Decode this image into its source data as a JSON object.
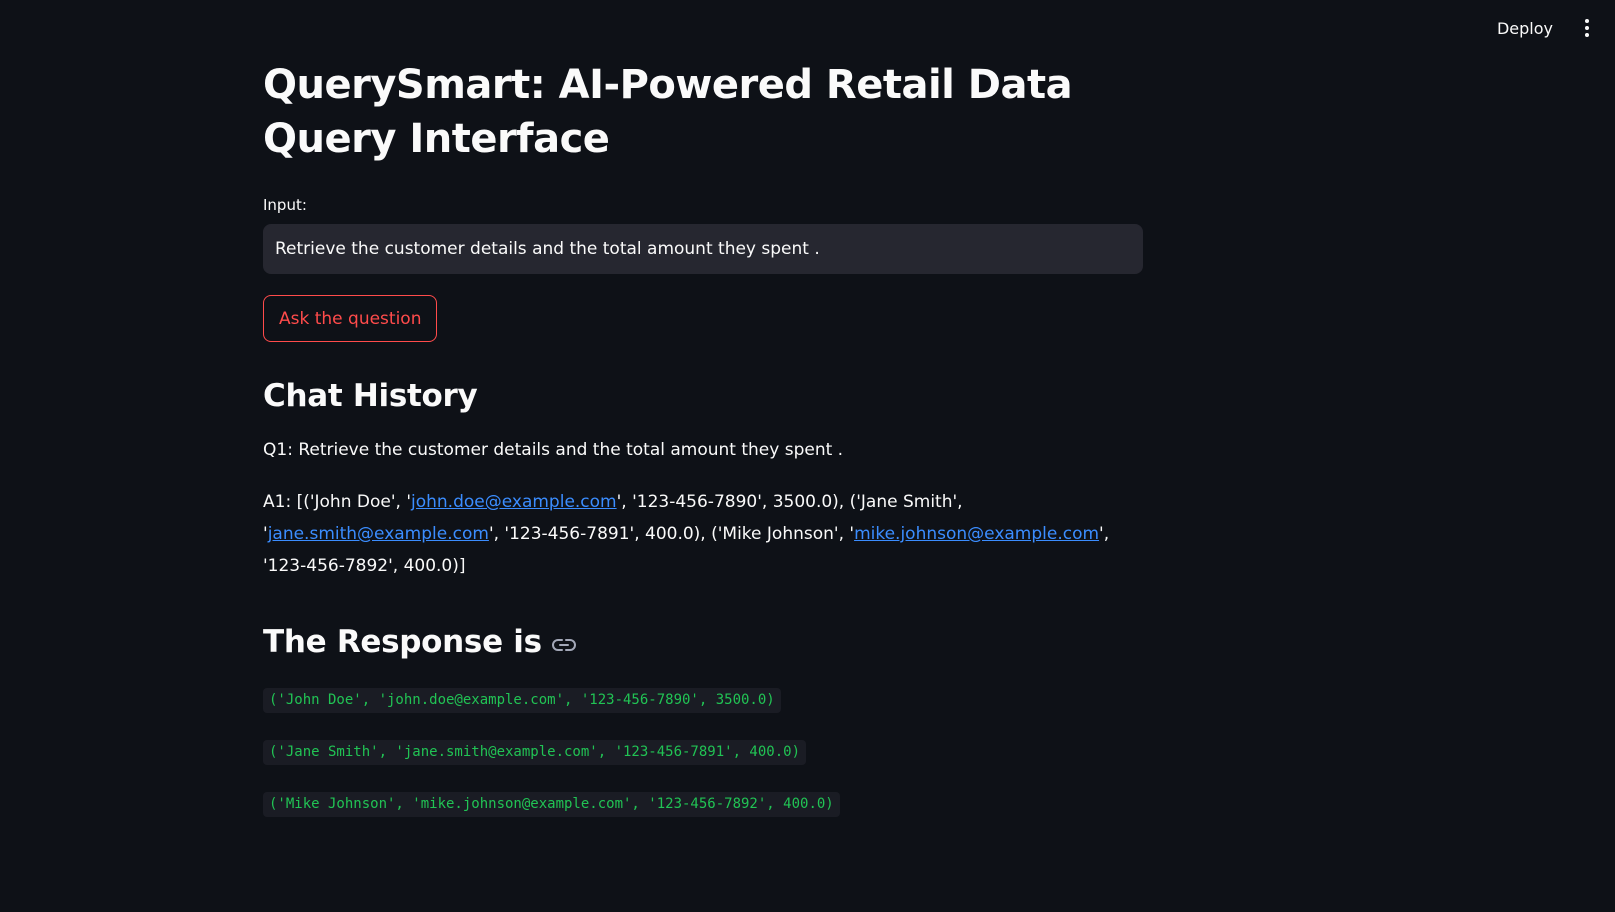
{
  "header": {
    "deploy_label": "Deploy",
    "menu_icon": "kebab-menu-icon"
  },
  "main": {
    "title": "QuerySmart: AI-Powered Retail Data Query Interface",
    "input_label": "Input:",
    "input_value": "Retrieve the customer details and the total amount they spent .",
    "ask_button_label": "Ask the question"
  },
  "chat": {
    "heading": "Chat History",
    "question": "Q1: Retrieve the customer details and the total amount they spent .",
    "answer_parts": {
      "p1": "A1: [('John Doe', '",
      "link1": "john.doe@example.com",
      "p2": "', '123-456-7890', 3500.0), ('Jane Smith', '",
      "link2": "jane.smith@example.com",
      "p3": "', '123-456-7891', 400.0), ('Mike Johnson', '",
      "link3": "mike.johnson@example.com",
      "p4": "', '123-456-7892', 400.0)]"
    }
  },
  "response": {
    "heading": "The Response is",
    "anchor_icon": "link-icon",
    "rows": [
      "('John Doe', 'john.doe@example.com', '123-456-7890', 3500.0)",
      "('Jane Smith', 'jane.smith@example.com', '123-456-7891', 400.0)",
      "('Mike Johnson', 'mike.johnson@example.com', '123-456-7892', 400.0)"
    ]
  },
  "colors": {
    "background": "#0e1117",
    "accent": "#ff4b4b",
    "link": "#3b8dff",
    "code_text": "#21c354"
  }
}
